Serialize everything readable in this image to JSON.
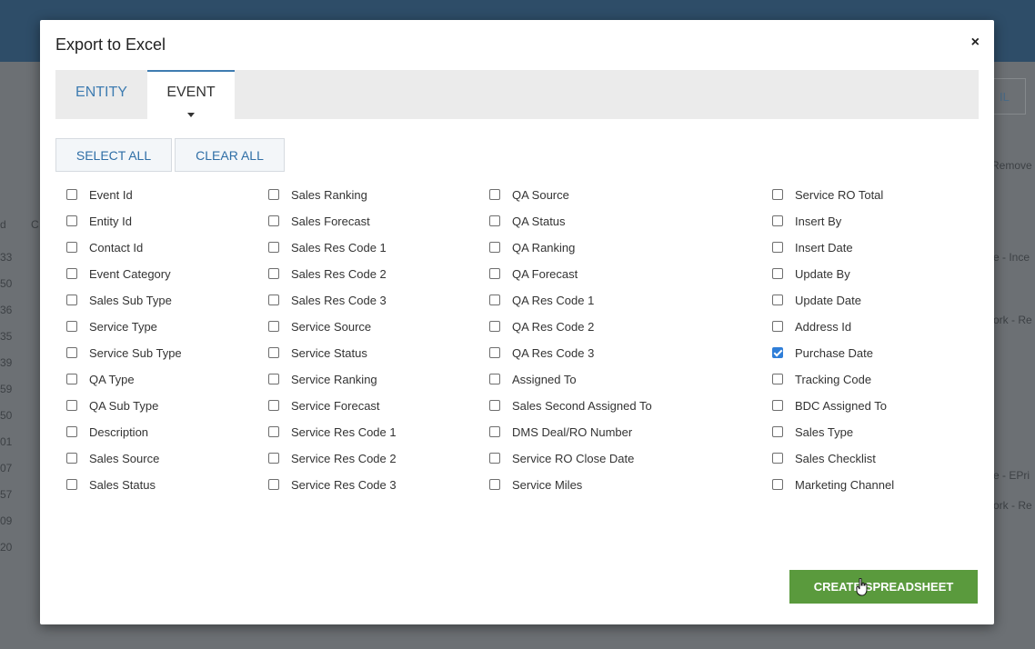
{
  "modal": {
    "title": "Export to Excel",
    "close_label": "×",
    "tabs": [
      {
        "label": "ENTITY",
        "active": false
      },
      {
        "label": "EVENT",
        "active": true
      }
    ],
    "select_all_label": "SELECT ALL",
    "clear_all_label": "CLEAR ALL",
    "create_label": "CREATE SPREADSHEET",
    "columns": [
      [
        {
          "label": "Event Id",
          "checked": false
        },
        {
          "label": "Entity Id",
          "checked": false
        },
        {
          "label": "Contact Id",
          "checked": false
        },
        {
          "label": "Event Category",
          "checked": false
        },
        {
          "label": "Sales Sub Type",
          "checked": false
        },
        {
          "label": "Service Type",
          "checked": false
        },
        {
          "label": "Service Sub Type",
          "checked": false
        },
        {
          "label": "QA Type",
          "checked": false
        },
        {
          "label": "QA Sub Type",
          "checked": false
        },
        {
          "label": "Description",
          "checked": false
        },
        {
          "label": "Sales Source",
          "checked": false
        },
        {
          "label": "Sales Status",
          "checked": false
        }
      ],
      [
        {
          "label": "Sales Ranking",
          "checked": false
        },
        {
          "label": "Sales Forecast",
          "checked": false
        },
        {
          "label": "Sales Res Code 1",
          "checked": false
        },
        {
          "label": "Sales Res Code 2",
          "checked": false
        },
        {
          "label": "Sales Res Code 3",
          "checked": false
        },
        {
          "label": "Service Source",
          "checked": false
        },
        {
          "label": "Service Status",
          "checked": false
        },
        {
          "label": "Service Ranking",
          "checked": false
        },
        {
          "label": "Service Forecast",
          "checked": false
        },
        {
          "label": "Service Res Code 1",
          "checked": false
        },
        {
          "label": "Service Res Code 2",
          "checked": false
        },
        {
          "label": "Service Res Code 3",
          "checked": false
        }
      ],
      [
        {
          "label": "QA Source",
          "checked": false
        },
        {
          "label": "QA Status",
          "checked": false
        },
        {
          "label": "QA Ranking",
          "checked": false
        },
        {
          "label": "QA Forecast",
          "checked": false
        },
        {
          "label": "QA Res Code 1",
          "checked": false
        },
        {
          "label": "QA Res Code 2",
          "checked": false
        },
        {
          "label": "QA Res Code 3",
          "checked": false
        },
        {
          "label": "Assigned To",
          "checked": false
        },
        {
          "label": "Sales Second Assigned To",
          "checked": false
        },
        {
          "label": "DMS Deal/RO Number",
          "checked": false
        },
        {
          "label": "Service RO Close Date",
          "checked": false
        },
        {
          "label": "Service Miles",
          "checked": false
        }
      ],
      [
        {
          "label": "Service RO Total",
          "checked": false
        },
        {
          "label": "Insert By",
          "checked": false
        },
        {
          "label": "Insert Date",
          "checked": false
        },
        {
          "label": "Update By",
          "checked": false
        },
        {
          "label": "Update Date",
          "checked": false
        },
        {
          "label": "Address Id",
          "checked": false
        },
        {
          "label": "Purchase Date",
          "checked": true
        },
        {
          "label": "Tracking Code",
          "checked": false
        },
        {
          "label": "BDC Assigned To",
          "checked": false
        },
        {
          "label": "Sales Type",
          "checked": false
        },
        {
          "label": "Sales Checklist",
          "checked": false
        },
        {
          "label": "Marketing Channel",
          "checked": false
        }
      ]
    ]
  },
  "background": {
    "button_label": "IL",
    "header_labels": [
      "Remove",
      "d",
      "C"
    ],
    "row_labels": [
      "33",
      "50",
      "36",
      "35",
      "39",
      "59",
      "50",
      "01",
      "07",
      "57",
      "09",
      "20"
    ],
    "right_fragments": [
      "e - Ince",
      "ork - Re",
      "e - EPri",
      "ork - Re"
    ]
  },
  "colors": {
    "accent": "#3e7cb1",
    "create_button": "#5a9a3d",
    "checkbox_checked": "#2f7ed8"
  }
}
